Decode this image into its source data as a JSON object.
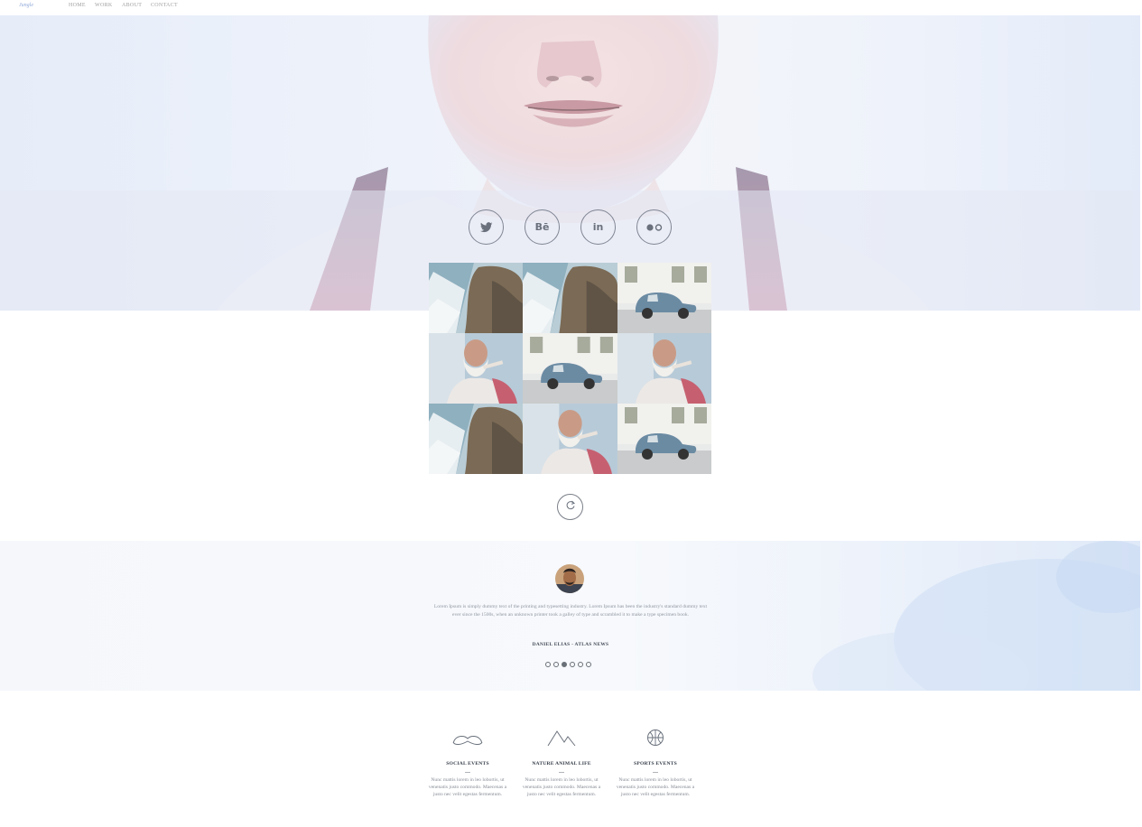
{
  "nav": {
    "logo": "Jungle",
    "links": [
      "HOME",
      "WORK",
      "ABOUT",
      "CONTACT"
    ]
  },
  "social": [
    {
      "name": "twitter-icon"
    },
    {
      "name": "behance-icon",
      "label": "Bē"
    },
    {
      "name": "linkedin-icon",
      "label": "in"
    },
    {
      "name": "flickr-icon"
    }
  ],
  "gallery": [
    "waterfall",
    "waterfall",
    "car",
    "old-man",
    "car",
    "old-man",
    "waterfall",
    "old-man",
    "car"
  ],
  "testimonial": {
    "quote": "Lorem Ipsum is simply dummy text of the printing and typesetting industry. Lorem Ipsum has been the industry's standard dummy text ever since the 1500s, when an unknown printer took a galley of type and scrambled it to make a type specimen book.",
    "author": "DANIEL ELIAS - ATLAS NEWS",
    "dots": 6,
    "active_dot": 2
  },
  "features": [
    {
      "icon": "mustache-icon",
      "title": "SOCIAL EVENTS",
      "text": "Nunc mattis lorem in leo lobortis, ut venenatis justo commodo. Maecenas a justo nec velit egestas fermentum."
    },
    {
      "icon": "mountain-icon",
      "title": "NATURE ANIMAL LIFE",
      "text": "Nunc mattis lorem in leo lobortis, ut venenatis justo commodo. Maecenas a justo nec velit egestas fermentum."
    },
    {
      "icon": "ball-icon",
      "title": "SPORTS EVENTS",
      "text": "Nunc mattis lorem in leo lobortis, ut venenatis justo commodo. Maecenas a justo nec velit egestas fermentum."
    }
  ]
}
